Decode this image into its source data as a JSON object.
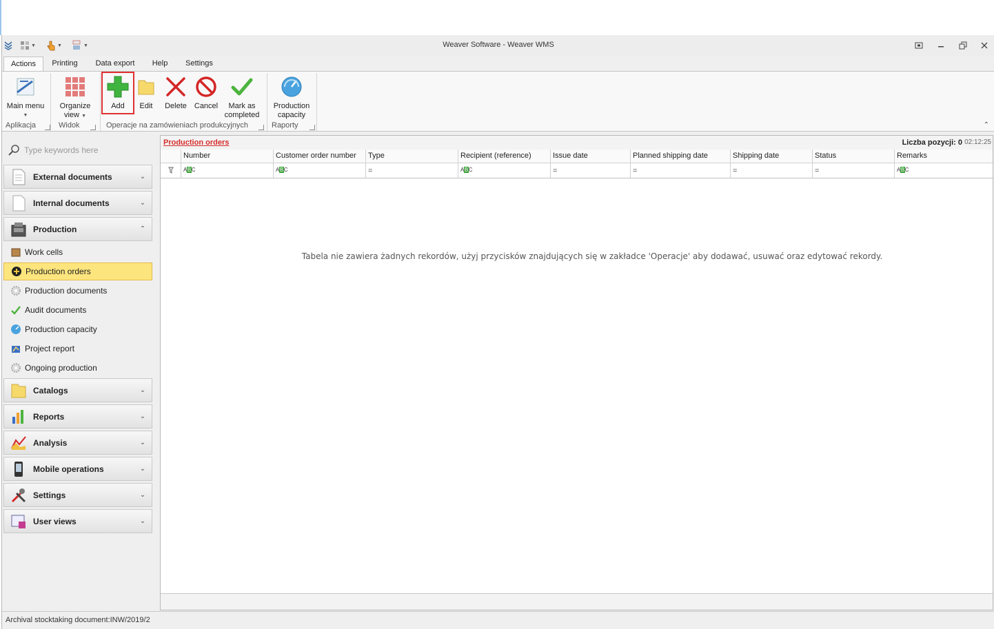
{
  "window": {
    "title": "Weaver Software - Weaver WMS"
  },
  "tabs": [
    "Actions",
    "Printing",
    "Data export",
    "Help",
    "Settings"
  ],
  "ribbon": {
    "buttons": {
      "main_menu": "Main menu",
      "organize_view_1": "Organize",
      "organize_view_2": "view",
      "add": "Add",
      "edit": "Edit",
      "delete": "Delete",
      "cancel": "Cancel",
      "mark_completed_1": "Mark as",
      "mark_completed_2": "completed",
      "production_capacity_1": "Production",
      "production_capacity_2": "capacity"
    },
    "groups": {
      "aplikacja": "Aplikacja",
      "widok": "Widok",
      "operacje": "Operacje na zamówieniach produkcyjnych",
      "raporty": "Raporty"
    }
  },
  "sidebar": {
    "search_placeholder": "Type keywords here",
    "sections": {
      "external": "External documents",
      "internal": "Internal documents",
      "production": "Production",
      "catalogs": "Catalogs",
      "reports": "Reports",
      "analysis": "Analysis",
      "mobile": "Mobile operations",
      "settings": "Settings",
      "user_views": "User views"
    },
    "production_items": [
      "Work cells",
      "Production orders",
      "Production documents",
      "Audit documents",
      "Production capacity",
      "Project report",
      "Ongoing production"
    ],
    "selected_item": "Production orders"
  },
  "main": {
    "title": "Production orders",
    "count_label": "Liczba pozycji: 0",
    "time": "02:12:25",
    "columns": [
      "Number",
      "Customer order number",
      "Type",
      "Recipient (reference)",
      "Issue date",
      "Planned shipping date",
      "Shipping date",
      "Status",
      "Remarks"
    ],
    "empty_message": "Tabela nie zawiera żadnych rekordów, użyj przycisków znajdujących się w zakładce 'Operacje' aby dodawać, usuwać oraz edytować rekordy."
  },
  "status_bar": {
    "text": "Archival stocktaking document:INW/2019/2"
  },
  "colors": {
    "selected_item_bg": "#fde57e",
    "title_link": "#d62b2b",
    "add_highlight_border": "#e03030"
  }
}
